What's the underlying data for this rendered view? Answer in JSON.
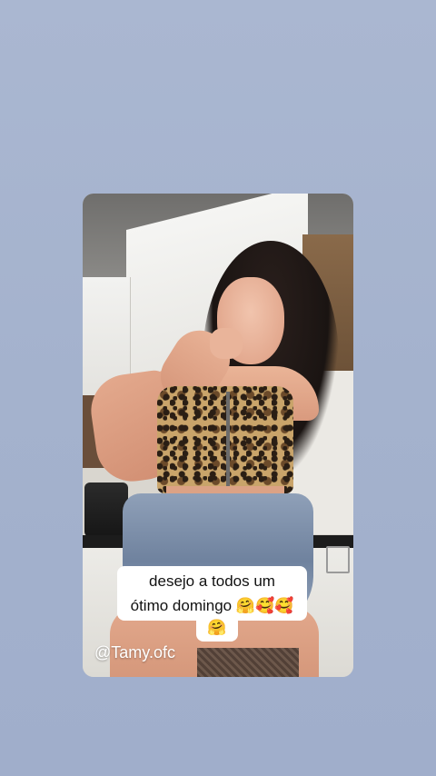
{
  "story": {
    "caption_line1": "desejo a todos um",
    "caption_line2": "ótimo domingo 🤗🥰🥰",
    "caption_line3": "🤗",
    "mention": "@Tamy.ofc"
  },
  "colors": {
    "background": "#a6b3ce",
    "caption_bg": "#ffffff",
    "caption_text": "#111111",
    "mention_text": "#ffffff"
  }
}
